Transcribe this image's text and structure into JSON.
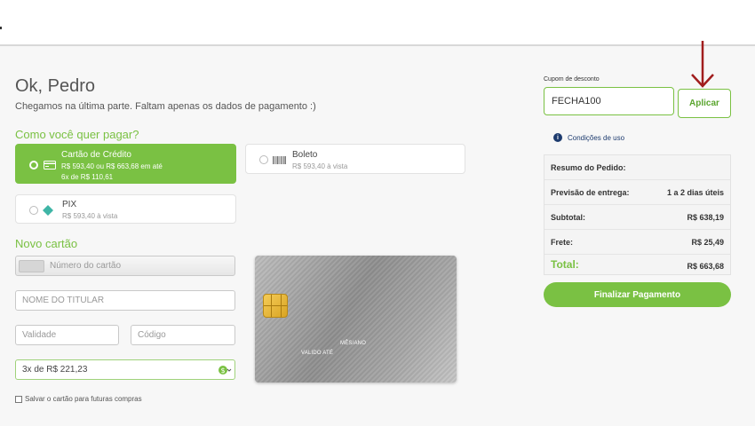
{
  "greeting": {
    "title": "Ok, Pedro",
    "subtitle": "Chegamos na última parte. Faltam apenas os dados de pagamento :)"
  },
  "payment": {
    "title": "Como você quer pagar?",
    "options": [
      {
        "name": "Cartão de Crédito",
        "desc1": "R$ 593,40 ou R$ 663,68 em até",
        "desc2": "6x de R$ 110,61",
        "icon": "credit-card-icon",
        "selected": true
      },
      {
        "name": "Boleto",
        "desc1": "R$ 593,40 à vista",
        "icon": "barcode-icon",
        "selected": false
      },
      {
        "name": "PIX",
        "desc1": "R$ 593,40 à vista",
        "icon": "pix-icon",
        "selected": false
      }
    ]
  },
  "new_card": {
    "title": "Novo cartão",
    "number_placeholder": "Número do cartão",
    "holder_placeholder": "NOME DO TITULAR",
    "validity_placeholder": "Validade",
    "code_placeholder": "Código",
    "installments_value": "3x de R$ 221,23",
    "save_label": "Salvar o cartão para futuras compras"
  },
  "card_preview": {
    "name_text": "MÊS/ANO",
    "valid_text": "VALIDO ATÉ"
  },
  "coupon": {
    "label": "Cupom de desconto",
    "value": "FECHA100",
    "apply_label": "Aplicar",
    "terms_label": "Condições de uso"
  },
  "summary": {
    "title": "Resumo do Pedido:",
    "delivery_label": "Previsão de entrega:",
    "delivery_value": "1 a 2 dias úteis",
    "subtotal_label": "Subtotal:",
    "subtotal_value": "R$ 638,19",
    "shipping_label": "Frete:",
    "shipping_value": "R$ 25,49",
    "total_label": "Total:",
    "total_value": "R$ 663,68"
  },
  "finalize_label": "Finalizar Pagamento",
  "colors": {
    "accent": "#7ac143",
    "info": "#1d3b6e",
    "arrow": "#a11d1d"
  }
}
